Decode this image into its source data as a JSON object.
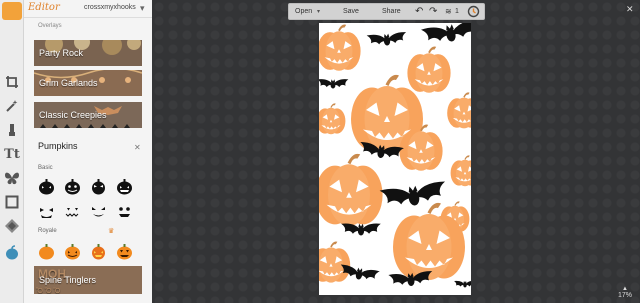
{
  "app": {
    "brand": "Editor",
    "user": "crossxmyxhooks"
  },
  "panel": {
    "section_label": "Overlays",
    "collections": [
      {
        "label": "Party Rock"
      },
      {
        "label": "Grim Garlands"
      },
      {
        "label": "Classic Creepies"
      },
      {
        "label": "Spine Tinglers"
      }
    ],
    "open_collection": {
      "title": "Pumpkins",
      "groups": [
        {
          "label": "Basic"
        },
        {
          "label": "Royale"
        }
      ]
    }
  },
  "toolbar": {
    "open_label": "Open",
    "save_label": "Save",
    "share_label": "Share",
    "layer_count": "1"
  },
  "zoom": {
    "level": "17%"
  },
  "colors": {
    "accent": "#3f8fb8",
    "brand": "#e0832d",
    "pumpkin": "#f8a35c",
    "bat": "#111111"
  },
  "icons": [
    "crop-icon",
    "magic-wand-icon",
    "brush-icon",
    "text-icon",
    "butterfly-icon",
    "frame-icon",
    "texture-icon",
    "apple-icon"
  ]
}
